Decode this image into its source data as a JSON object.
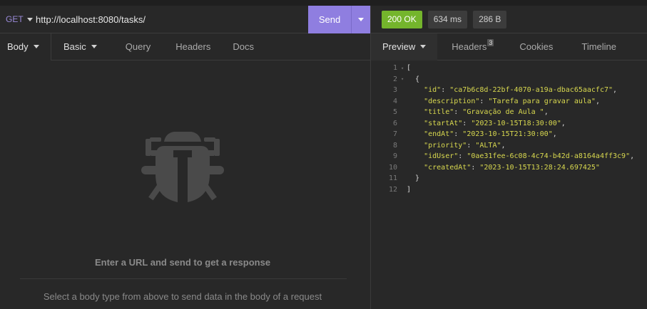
{
  "request": {
    "method": "GET",
    "url": "http://localhost:8080/tasks/",
    "send_label": "Send"
  },
  "response": {
    "status": "200 OK",
    "time": "634 ms",
    "size": "286 B"
  },
  "left_tabs": {
    "body": "Body",
    "basic": "Basic",
    "query": "Query",
    "headers": "Headers",
    "docs": "Docs"
  },
  "right_tabs": {
    "preview": "Preview",
    "headers": "Headers",
    "headers_count": "3",
    "cookies": "Cookies",
    "timeline": "Timeline"
  },
  "empty_state": {
    "title": "Enter a URL and send to get a response",
    "hint": "Select a body type from above to send data in the body of a request"
  },
  "json_lines": [
    {
      "n": "1",
      "fold": "▾",
      "text": "["
    },
    {
      "n": "2",
      "fold": "▾",
      "text": "  {"
    },
    {
      "n": "3",
      "fold": "",
      "key": "\"id\"",
      "val": "\"ca7b6c8d-22bf-4070-a19a-dbac65aacfc7\"",
      "end": ","
    },
    {
      "n": "4",
      "fold": "",
      "key": "\"description\"",
      "val": "\"Tarefa para gravar aula\"",
      "end": ","
    },
    {
      "n": "5",
      "fold": "",
      "key": "\"title\"",
      "val": "\"Gravação de Aula \"",
      "end": ","
    },
    {
      "n": "6",
      "fold": "",
      "key": "\"startAt\"",
      "val": "\"2023-10-15T18:30:00\"",
      "end": ","
    },
    {
      "n": "7",
      "fold": "",
      "key": "\"endAt\"",
      "val": "\"2023-10-15T21:30:00\"",
      "end": ","
    },
    {
      "n": "8",
      "fold": "",
      "key": "\"priority\"",
      "val": "\"ALTA\"",
      "end": ","
    },
    {
      "n": "9",
      "fold": "",
      "key": "\"idUser\"",
      "val": "\"0ae31fee-6c08-4c74-b42d-a8164a4ff3c9\"",
      "end": ","
    },
    {
      "n": "10",
      "fold": "",
      "key": "\"createdAt\"",
      "val": "\"2023-10-15T13:28:24.697425\"",
      "end": ""
    },
    {
      "n": "11",
      "fold": "",
      "text": "  }"
    },
    {
      "n": "12",
      "fold": "",
      "text": "]"
    }
  ],
  "icons": {
    "empty_illustration": "bug-icon",
    "dropdown": "chevron-down-icon"
  },
  "colors": {
    "accent": "#8f7ee0",
    "status_ok": "#74b52c",
    "json_string": "#d8d84f"
  }
}
